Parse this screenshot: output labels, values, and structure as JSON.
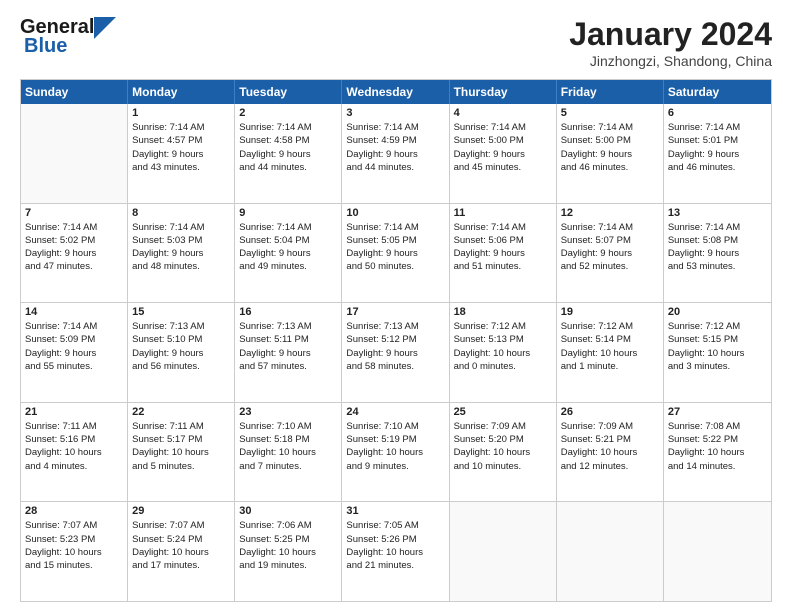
{
  "logo": {
    "line1": "General",
    "line2": "Blue"
  },
  "title": "January 2024",
  "location": "Jinzhongzi, Shandong, China",
  "dayNames": [
    "Sunday",
    "Monday",
    "Tuesday",
    "Wednesday",
    "Thursday",
    "Friday",
    "Saturday"
  ],
  "rows": [
    [
      {
        "date": "",
        "info": "",
        "empty": true
      },
      {
        "date": "1",
        "info": "Sunrise: 7:14 AM\nSunset: 4:57 PM\nDaylight: 9 hours\nand 43 minutes."
      },
      {
        "date": "2",
        "info": "Sunrise: 7:14 AM\nSunset: 4:58 PM\nDaylight: 9 hours\nand 44 minutes."
      },
      {
        "date": "3",
        "info": "Sunrise: 7:14 AM\nSunset: 4:59 PM\nDaylight: 9 hours\nand 44 minutes."
      },
      {
        "date": "4",
        "info": "Sunrise: 7:14 AM\nSunset: 5:00 PM\nDaylight: 9 hours\nand 45 minutes."
      },
      {
        "date": "5",
        "info": "Sunrise: 7:14 AM\nSunset: 5:00 PM\nDaylight: 9 hours\nand 46 minutes."
      },
      {
        "date": "6",
        "info": "Sunrise: 7:14 AM\nSunset: 5:01 PM\nDaylight: 9 hours\nand 46 minutes."
      }
    ],
    [
      {
        "date": "7",
        "info": "Sunrise: 7:14 AM\nSunset: 5:02 PM\nDaylight: 9 hours\nand 47 minutes."
      },
      {
        "date": "8",
        "info": "Sunrise: 7:14 AM\nSunset: 5:03 PM\nDaylight: 9 hours\nand 48 minutes."
      },
      {
        "date": "9",
        "info": "Sunrise: 7:14 AM\nSunset: 5:04 PM\nDaylight: 9 hours\nand 49 minutes."
      },
      {
        "date": "10",
        "info": "Sunrise: 7:14 AM\nSunset: 5:05 PM\nDaylight: 9 hours\nand 50 minutes."
      },
      {
        "date": "11",
        "info": "Sunrise: 7:14 AM\nSunset: 5:06 PM\nDaylight: 9 hours\nand 51 minutes."
      },
      {
        "date": "12",
        "info": "Sunrise: 7:14 AM\nSunset: 5:07 PM\nDaylight: 9 hours\nand 52 minutes."
      },
      {
        "date": "13",
        "info": "Sunrise: 7:14 AM\nSunset: 5:08 PM\nDaylight: 9 hours\nand 53 minutes."
      }
    ],
    [
      {
        "date": "14",
        "info": "Sunrise: 7:14 AM\nSunset: 5:09 PM\nDaylight: 9 hours\nand 55 minutes."
      },
      {
        "date": "15",
        "info": "Sunrise: 7:13 AM\nSunset: 5:10 PM\nDaylight: 9 hours\nand 56 minutes."
      },
      {
        "date": "16",
        "info": "Sunrise: 7:13 AM\nSunset: 5:11 PM\nDaylight: 9 hours\nand 57 minutes."
      },
      {
        "date": "17",
        "info": "Sunrise: 7:13 AM\nSunset: 5:12 PM\nDaylight: 9 hours\nand 58 minutes."
      },
      {
        "date": "18",
        "info": "Sunrise: 7:12 AM\nSunset: 5:13 PM\nDaylight: 10 hours\nand 0 minutes."
      },
      {
        "date": "19",
        "info": "Sunrise: 7:12 AM\nSunset: 5:14 PM\nDaylight: 10 hours\nand 1 minute."
      },
      {
        "date": "20",
        "info": "Sunrise: 7:12 AM\nSunset: 5:15 PM\nDaylight: 10 hours\nand 3 minutes."
      }
    ],
    [
      {
        "date": "21",
        "info": "Sunrise: 7:11 AM\nSunset: 5:16 PM\nDaylight: 10 hours\nand 4 minutes."
      },
      {
        "date": "22",
        "info": "Sunrise: 7:11 AM\nSunset: 5:17 PM\nDaylight: 10 hours\nand 5 minutes."
      },
      {
        "date": "23",
        "info": "Sunrise: 7:10 AM\nSunset: 5:18 PM\nDaylight: 10 hours\nand 7 minutes."
      },
      {
        "date": "24",
        "info": "Sunrise: 7:10 AM\nSunset: 5:19 PM\nDaylight: 10 hours\nand 9 minutes."
      },
      {
        "date": "25",
        "info": "Sunrise: 7:09 AM\nSunset: 5:20 PM\nDaylight: 10 hours\nand 10 minutes."
      },
      {
        "date": "26",
        "info": "Sunrise: 7:09 AM\nSunset: 5:21 PM\nDaylight: 10 hours\nand 12 minutes."
      },
      {
        "date": "27",
        "info": "Sunrise: 7:08 AM\nSunset: 5:22 PM\nDaylight: 10 hours\nand 14 minutes."
      }
    ],
    [
      {
        "date": "28",
        "info": "Sunrise: 7:07 AM\nSunset: 5:23 PM\nDaylight: 10 hours\nand 15 minutes."
      },
      {
        "date": "29",
        "info": "Sunrise: 7:07 AM\nSunset: 5:24 PM\nDaylight: 10 hours\nand 17 minutes."
      },
      {
        "date": "30",
        "info": "Sunrise: 7:06 AM\nSunset: 5:25 PM\nDaylight: 10 hours\nand 19 minutes."
      },
      {
        "date": "31",
        "info": "Sunrise: 7:05 AM\nSunset: 5:26 PM\nDaylight: 10 hours\nand 21 minutes."
      },
      {
        "date": "",
        "info": "",
        "empty": true
      },
      {
        "date": "",
        "info": "",
        "empty": true
      },
      {
        "date": "",
        "info": "",
        "empty": true
      }
    ]
  ]
}
